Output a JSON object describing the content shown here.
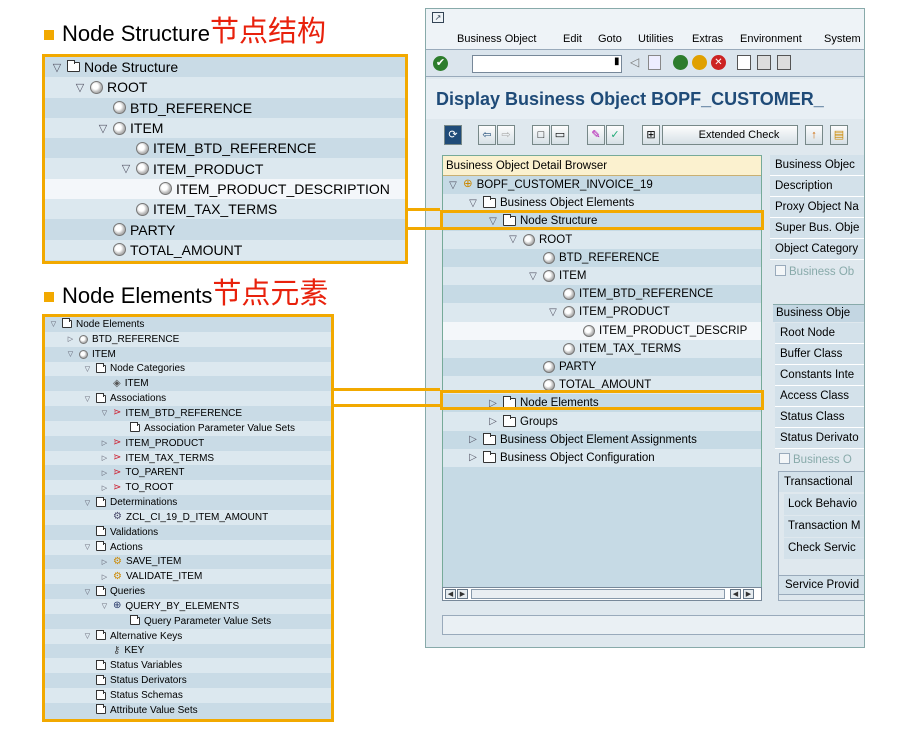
{
  "headings": {
    "node_structure_en": "Node Structure",
    "node_structure_cn": "节点结构",
    "node_elements_en": "Node Elements",
    "node_elements_cn": "节点元素"
  },
  "colors": {
    "accent_orange": "#f2a900",
    "cn_red": "#e8210c",
    "title_blue": "#1f4b78",
    "tree_bg": "#c9dbe6",
    "header_yellow": "#fbf1cf"
  },
  "ns_tree": [
    {
      "label": "Node Structure",
      "icon": "folder-icon",
      "toggle": "expanded"
    },
    {
      "label": "ROOT",
      "icon": "node-icon",
      "toggle": "expanded"
    },
    {
      "label": "BTD_REFERENCE",
      "icon": "node-icon"
    },
    {
      "label": "ITEM",
      "icon": "node-icon",
      "toggle": "expanded"
    },
    {
      "label": "ITEM_BTD_REFERENCE",
      "icon": "node-icon"
    },
    {
      "label": "ITEM_PRODUCT",
      "icon": "node-icon",
      "toggle": "expanded"
    },
    {
      "label": "ITEM_PRODUCT_DESCRIPTION",
      "icon": "node-icon"
    },
    {
      "label": "ITEM_TAX_TERMS",
      "icon": "node-icon"
    },
    {
      "label": "PARTY",
      "icon": "node-icon"
    },
    {
      "label": "TOTAL_AMOUNT",
      "icon": "node-icon"
    }
  ],
  "ne_tree": [
    {
      "label": "Node Elements",
      "icon": "folder-icon",
      "toggle": "expanded"
    },
    {
      "label": "BTD_REFERENCE",
      "icon": "node-icon",
      "toggle": "collapsed"
    },
    {
      "label": "ITEM",
      "icon": "node-icon",
      "toggle": "expanded"
    },
    {
      "label": "Node Categories",
      "icon": "folder-icon",
      "toggle": "expanded"
    },
    {
      "label": "ITEM",
      "icon": "category-icon"
    },
    {
      "label": "Associations",
      "icon": "folder-icon",
      "toggle": "expanded"
    },
    {
      "label": "ITEM_BTD_REFERENCE",
      "icon": "association-icon",
      "toggle": "expanded"
    },
    {
      "label": "Association Parameter Value Sets",
      "icon": "folder-icon"
    },
    {
      "label": "ITEM_PRODUCT",
      "icon": "association-icon",
      "toggle": "collapsed"
    },
    {
      "label": "ITEM_TAX_TERMS",
      "icon": "association-icon",
      "toggle": "collapsed"
    },
    {
      "label": "TO_PARENT",
      "icon": "association-icon",
      "toggle": "collapsed"
    },
    {
      "label": "TO_ROOT",
      "icon": "association-icon",
      "toggle": "collapsed"
    },
    {
      "label": "Determinations",
      "icon": "folder-icon",
      "toggle": "expanded"
    },
    {
      "label": "ZCL_CI_19_D_ITEM_AMOUNT",
      "icon": "determination-icon"
    },
    {
      "label": "Validations",
      "icon": "folder-icon"
    },
    {
      "label": "Actions",
      "icon": "folder-icon",
      "toggle": "expanded"
    },
    {
      "label": "SAVE_ITEM",
      "icon": "action-icon",
      "toggle": "collapsed"
    },
    {
      "label": "VALIDATE_ITEM",
      "icon": "action-icon",
      "toggle": "collapsed"
    },
    {
      "label": "Queries",
      "icon": "folder-icon",
      "toggle": "expanded"
    },
    {
      "label": "QUERY_BY_ELEMENTS",
      "icon": "query-icon",
      "toggle": "expanded"
    },
    {
      "label": "Query Parameter Value Sets",
      "icon": "folder-icon"
    },
    {
      "label": "Alternative Keys",
      "icon": "folder-icon",
      "toggle": "expanded"
    },
    {
      "label": "KEY",
      "icon": "key-icon"
    },
    {
      "label": "Status Variables",
      "icon": "folder-icon"
    },
    {
      "label": "Status Derivators",
      "icon": "folder-icon"
    },
    {
      "label": "Status Schemas",
      "icon": "folder-icon"
    },
    {
      "label": "Attribute Value Sets",
      "icon": "folder-icon"
    }
  ],
  "sap": {
    "menu": [
      "Business Object",
      "Edit",
      "Goto",
      "Utilities",
      "Extras",
      "Environment",
      "System"
    ],
    "title": "Display Business Object BOPF_CUSTOMER_",
    "extended_check": "Extended Check",
    "tree_header": "Business Object Detail Browser",
    "tree": [
      {
        "label": "BOPF_CUSTOMER_INVOICE_19",
        "icon": "bo-icon",
        "toggle": "expanded"
      },
      {
        "label": "Business Object Elements",
        "icon": "folder-icon",
        "toggle": "expanded"
      },
      {
        "label": "Node Structure",
        "icon": "folder-icon",
        "toggle": "expanded"
      },
      {
        "label": "ROOT",
        "icon": "node-icon",
        "toggle": "expanded"
      },
      {
        "label": "BTD_REFERENCE",
        "icon": "node-icon"
      },
      {
        "label": "ITEM",
        "icon": "node-icon",
        "toggle": "expanded"
      },
      {
        "label": "ITEM_BTD_REFERENCE",
        "icon": "node-icon"
      },
      {
        "label": "ITEM_PRODUCT",
        "icon": "node-icon",
        "toggle": "expanded"
      },
      {
        "label": "ITEM_PRODUCT_DESCRIP",
        "icon": "node-icon"
      },
      {
        "label": "ITEM_TAX_TERMS",
        "icon": "node-icon"
      },
      {
        "label": "PARTY",
        "icon": "node-icon"
      },
      {
        "label": "TOTAL_AMOUNT",
        "icon": "node-icon"
      },
      {
        "label": "Node Elements",
        "icon": "folder-icon",
        "toggle": "collapsed"
      },
      {
        "label": "Groups",
        "icon": "folder-icon",
        "toggle": "collapsed"
      },
      {
        "label": "Business Object Element Assignments",
        "icon": "folder-icon",
        "toggle": "collapsed"
      },
      {
        "label": "Business Object Configuration",
        "icon": "folder-icon",
        "toggle": "collapsed"
      }
    ],
    "fields_top": [
      "Business Objec",
      "Description",
      "Proxy Object Na",
      "Super Bus. Obje",
      "Object Category"
    ],
    "checkbox1": "Business Ob",
    "section_header": "Business Obje",
    "fields_mid": [
      "Root Node",
      "Buffer Class",
      "Constants Inte",
      "Access Class",
      "Status Class",
      "Status Derivato"
    ],
    "checkbox2": "Business O",
    "trans_header": "Transactional",
    "trans_fields": [
      "Lock Behavio",
      "Transaction M",
      "Check Servic"
    ],
    "service_provider": "Service Provid"
  }
}
